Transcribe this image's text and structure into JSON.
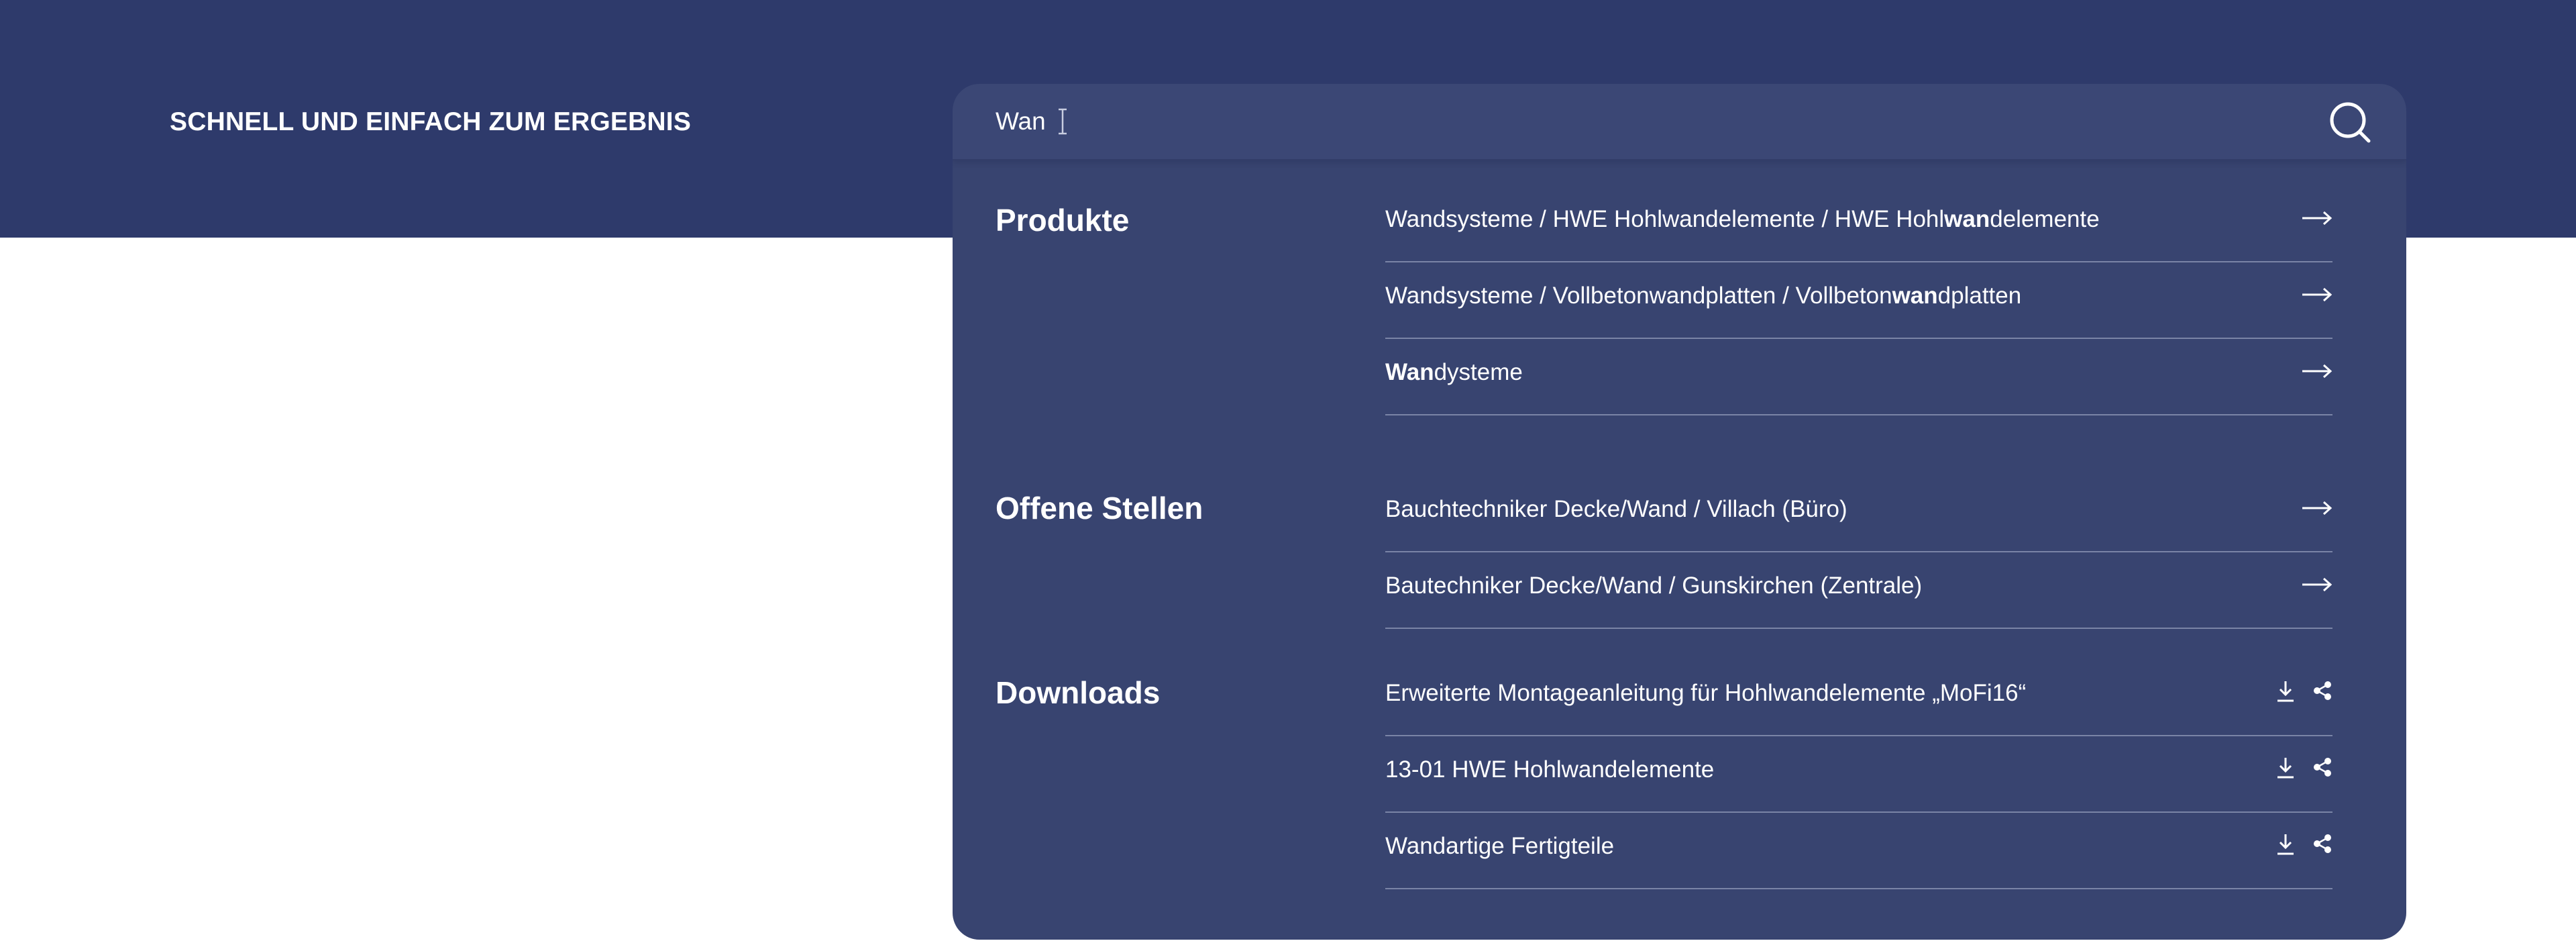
{
  "hero": {
    "title": "SCHNELL UND EINFACH ZUM ERGEBNIS",
    "background_color": "#2e3a6b"
  },
  "search": {
    "value": "Wan",
    "icon": "search-icon"
  },
  "panel": {
    "background_color": "#384470"
  },
  "sections": [
    {
      "title": "Produkte",
      "items": [
        {
          "pre": "Wandsysteme / HWE Hohlwandelemente / HWE Hohl",
          "match": "wan",
          "post": "delemente",
          "icon": "arrow-right-icon"
        },
        {
          "pre": "Wandsysteme / Vollbetonwandplatten / Vollbeton",
          "match": "wan",
          "post": "dplatten",
          "icon": "arrow-right-icon"
        },
        {
          "pre": "",
          "match": "Wan",
          "post": "dysteme",
          "icon": "arrow-right-icon"
        }
      ]
    },
    {
      "title": "Offene Stellen",
      "items": [
        {
          "pre": "Bauchtechniker Decke/Wand / Villach (Büro)",
          "match": "",
          "post": "",
          "icon": "arrow-right-icon"
        },
        {
          "pre": "Bautechniker Decke/Wand / Gunskirchen (Zentrale)",
          "match": "",
          "post": "",
          "icon": "arrow-right-icon"
        }
      ]
    },
    {
      "title": "Downloads",
      "items": [
        {
          "pre": "Erweiterte Montageanleitung für Hohlwandelemente „MoFi16“",
          "match": "",
          "post": "",
          "icon": "download-icon"
        },
        {
          "pre": "13-01 HWE Hohlwandelemente",
          "match": "",
          "post": "",
          "icon": "download-icon"
        },
        {
          "pre": "Wandartige Fertigteile",
          "match": "",
          "post": "",
          "icon": "download-icon"
        }
      ]
    }
  ]
}
